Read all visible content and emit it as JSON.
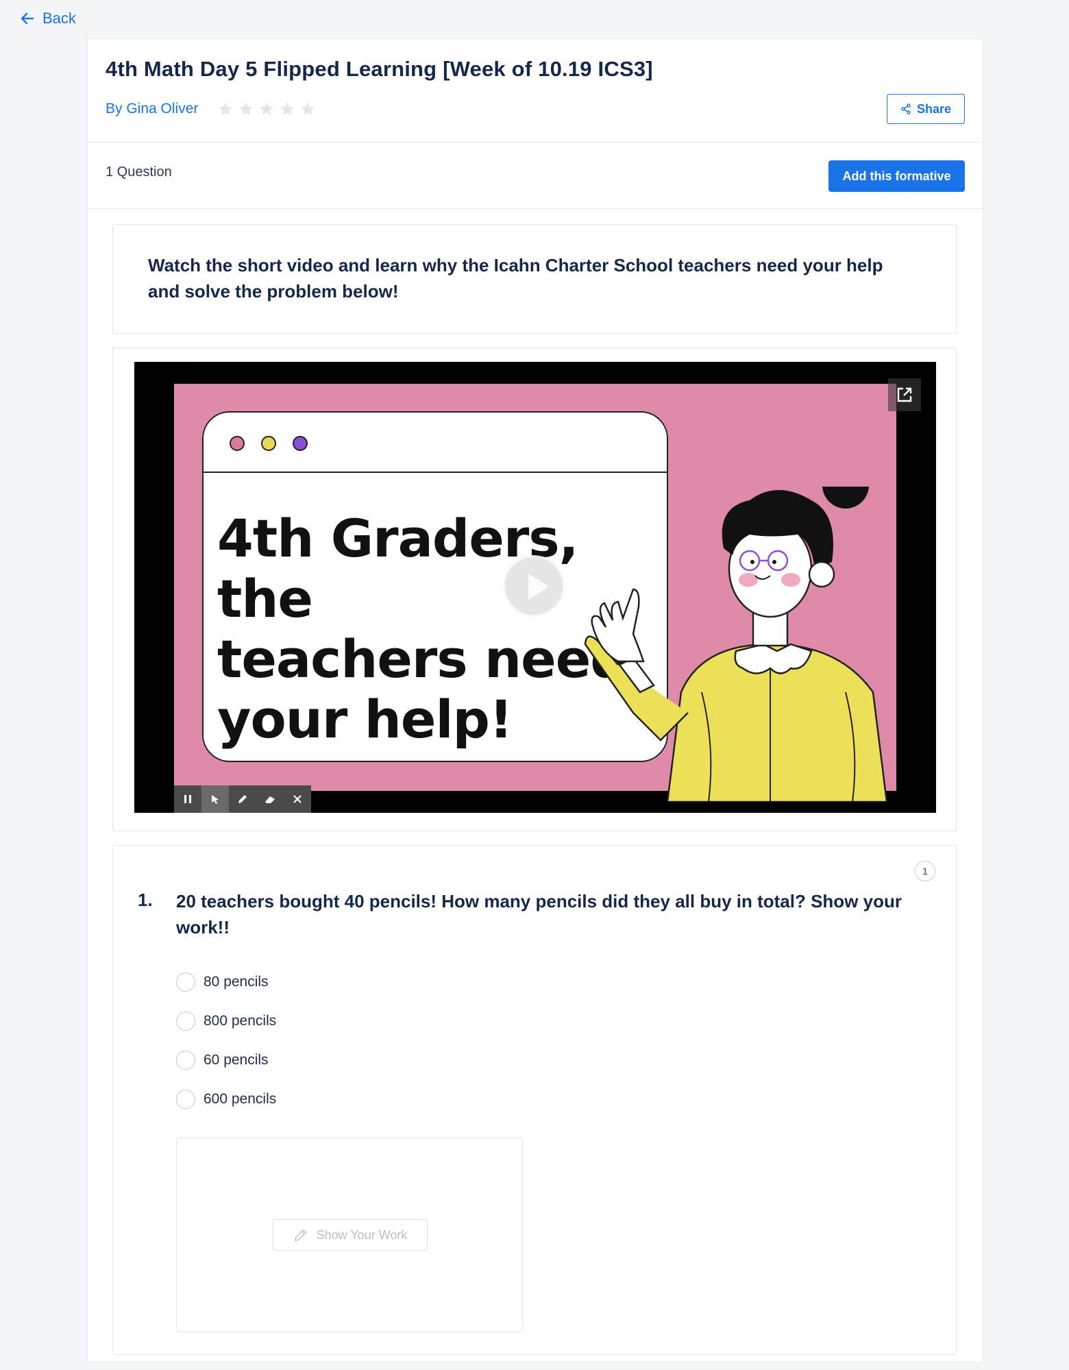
{
  "nav": {
    "back_label": "Back"
  },
  "header": {
    "title": "4th Math Day 5 Flipped Learning [Week of 10.19 ICS3]",
    "author": "By Gina Oliver",
    "rating": {
      "filled": 0,
      "max": 5
    },
    "share_label": "Share"
  },
  "toolbar": {
    "question_count": "1 Question",
    "add_label": "Add this formative"
  },
  "instructions": {
    "text": "Watch the short video and learn why the Icahn Charter School teachers need your help and solve the problem below!"
  },
  "video": {
    "slide_text": "4th Graders, the\nteachers need\nyour help!",
    "colors": {
      "background": "#e08aa9",
      "shirt": "#ece058",
      "dot1": "#d97b9c",
      "dot2": "#e9d958",
      "dot3": "#8a4fd8"
    },
    "controls": [
      "pause-icon",
      "pointer-icon",
      "pencil-icon",
      "eraser-icon",
      "close-icon"
    ]
  },
  "question": {
    "badge": "1",
    "number": "1.",
    "text": "20 teachers bought 40 pencils! How many pencils did they all buy in total? Show your work!!",
    "options": [
      "80 pencils",
      "800 pencils",
      "60 pencils",
      "600 pencils"
    ],
    "show_work_label": "Show Your Work"
  },
  "colors": {
    "accent": "#1a73e8",
    "title": "#14284b"
  }
}
